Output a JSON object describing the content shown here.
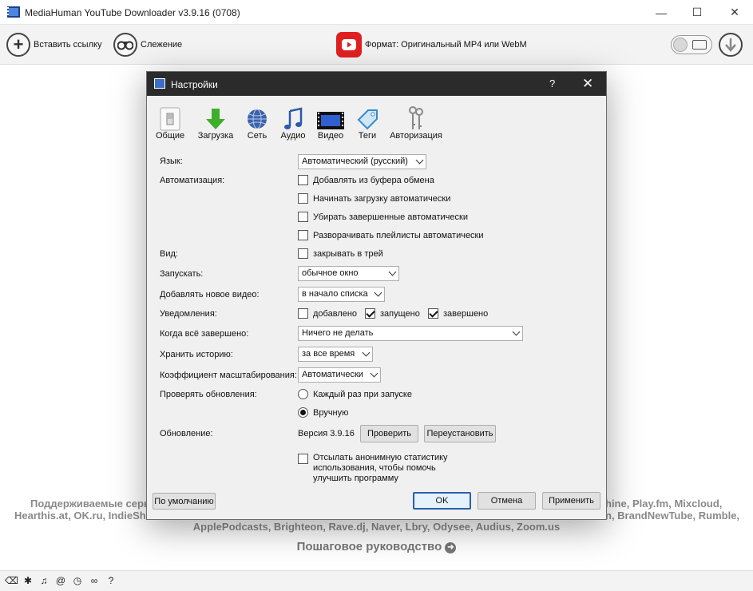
{
  "window": {
    "title": "MediaHuman YouTube Downloader v3.9.16 (0708)"
  },
  "toolbar": {
    "paste_label": "Вставить ссылку",
    "tracking_label": "Слежение",
    "format_label": "Формат: Оригинальный MP4 или WebM"
  },
  "background": {
    "line1_left": "Поддерживаемые серв",
    "line1_right": "hine, Play.fm, Mixcloud,",
    "line2_left": "Hearthis.at, OK.ru, IndieSh",
    "line2_right": "n, BrandNewTube, Rumble,",
    "line3": "ApplePodcasts, Brighteon, Rave.dj, Naver, Lbry, Odysee, Audius, Zoom.us",
    "guide": "Пошаговое руководство"
  },
  "dialog": {
    "title": "Настройки",
    "help": "?",
    "close": "✕",
    "tabs": [
      {
        "label": "Общие",
        "icon": "switch-icon"
      },
      {
        "label": "Загрузка",
        "icon": "download-arrow-icon"
      },
      {
        "label": "Сеть",
        "icon": "globe-icon"
      },
      {
        "label": "Аудио",
        "icon": "music-note-icon"
      },
      {
        "label": "Видео",
        "icon": "film-icon"
      },
      {
        "label": "Теги",
        "icon": "tag-icon"
      },
      {
        "label": "Авторизация",
        "icon": "keys-icon"
      }
    ],
    "language": {
      "label": "Язык:",
      "value": "Автоматический (русский)"
    },
    "automation": {
      "label": "Автоматизация:",
      "options": [
        {
          "text": "Добавлять из буфера обмена",
          "checked": false
        },
        {
          "text": "Начинать загрузку автоматически",
          "checked": false
        },
        {
          "text": "Убирать завершенные автоматически",
          "checked": false
        },
        {
          "text": "Разворачивать плейлисты автоматически",
          "checked": false
        }
      ]
    },
    "view": {
      "label": "Вид:",
      "option": "закрывать в трей",
      "checked": false
    },
    "launch": {
      "label": "Запускать:",
      "value": "обычное окно"
    },
    "add_new": {
      "label": "Добавлять новое видео:",
      "value": "в начало списка"
    },
    "notifications": {
      "label": "Уведомления:",
      "options": [
        {
          "text": "добавлено",
          "checked": false
        },
        {
          "text": "запущено",
          "checked": true
        },
        {
          "text": "завершено",
          "checked": true
        }
      ]
    },
    "when_done": {
      "label": "Когда всё завершено:",
      "value": "Ничего не делать"
    },
    "history": {
      "label": "Хранить историю:",
      "value": "за все время"
    },
    "scale": {
      "label": "Коэффициент масштабирования:",
      "value": "Автоматически"
    },
    "updates_check": {
      "label": "Проверять обновления:",
      "options": [
        {
          "text": "Каждый раз при запуске",
          "selected": false
        },
        {
          "text": "Вручную",
          "selected": true
        }
      ]
    },
    "update": {
      "label": "Обновление:",
      "version": "Версия 3.9.16",
      "check_btn": "Проверить",
      "reinstall_btn": "Переустановить"
    },
    "stats": {
      "text": "Отсылать анонимную статистику использования, чтобы помочь улучшить программу",
      "checked": false
    },
    "buttons": {
      "defaults": "По умолчанию",
      "ok": "OK",
      "cancel": "Отмена",
      "apply": "Применить"
    }
  }
}
